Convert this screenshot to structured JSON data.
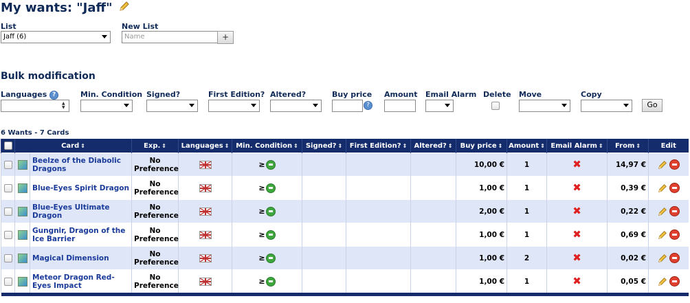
{
  "page": {
    "title": "My wants: \"Jaff\""
  },
  "list": {
    "label": "List",
    "value": "Jaff (6)",
    "new_list_label": "New List",
    "new_list_placeholder": "Name",
    "add_button": "+"
  },
  "bulk": {
    "heading": "Bulk modification",
    "languages_label": "Languages",
    "min_condition_label": "Min. Condition",
    "signed_label": "Signed?",
    "first_edition_label": "First Edition?",
    "altered_label": "Altered?",
    "buy_price_label": "Buy price",
    "amount_label": "Amount",
    "email_alarm_label": "Email Alarm",
    "delete_label": "Delete",
    "move_label": "Move",
    "copy_label": "Copy",
    "go_button": "Go",
    "help_glyph": "?"
  },
  "summary": "6 Wants - 7 Cards",
  "table": {
    "columns": [
      "Card",
      "Exp.",
      "Languages",
      "Min. Condition",
      "Signed?",
      "First Edition?",
      "Altered?",
      "Buy price",
      "Amount",
      "Email Alarm",
      "From",
      "Edit"
    ],
    "sort_glyph": "⇕",
    "rows": [
      {
        "card": "Beelze of the Diabolic Dragons",
        "exp": "No Preference",
        "condition": "≥",
        "buy_price": "10,00 €",
        "amount": "1",
        "from": "14,97 €"
      },
      {
        "card": "Blue-Eyes Spirit Dragon",
        "exp": "No Preference",
        "condition": "≥",
        "buy_price": "1,00 €",
        "amount": "1",
        "from": "0,39 €"
      },
      {
        "card": "Blue-Eyes Ultimate Dragon",
        "exp": "No Preference",
        "condition": "≥",
        "buy_price": "2,00 €",
        "amount": "1",
        "from": "0,22 €"
      },
      {
        "card": "Gungnir, Dragon of the Ice Barrier",
        "exp": "No Preference",
        "condition": "≥",
        "buy_price": "1,00 €",
        "amount": "1",
        "from": "0,69 €"
      },
      {
        "card": "Magical Dimension",
        "exp": "No Preference",
        "condition": "≥",
        "buy_price": "1,00 €",
        "amount": "2",
        "from": "0,02 €"
      },
      {
        "card": "Meteor Dragon Red-Eyes Impact",
        "exp": "No Preference",
        "condition": "≥",
        "buy_price": "1,00 €",
        "amount": "1",
        "from": "0,05 €"
      }
    ]
  },
  "icons": {
    "title_edit": "pencil-icon",
    "card_image": "image-icon",
    "language": "flag-icon",
    "condition": "condition-badge-icon",
    "email_alarm": "red-x-icon",
    "edit": "pencil-icon",
    "delete": "delete-icon"
  },
  "colors": {
    "heading": "#102a58",
    "table_header_bg": "#142c6c",
    "row_alt_bg": "#dfe6f8",
    "link": "#1a3b9a",
    "alarm_off": "#e02020"
  }
}
